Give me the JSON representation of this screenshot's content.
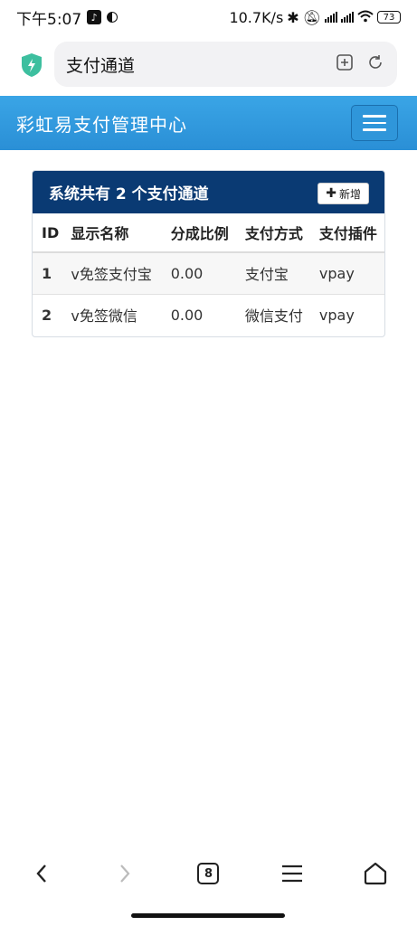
{
  "status_bar": {
    "time": "下午5:07",
    "network_speed": "10.7K/s",
    "battery": "73"
  },
  "browser": {
    "url_title": "支付通道",
    "tab_count": "8"
  },
  "app": {
    "title": "彩虹易支付管理中心"
  },
  "panel": {
    "title": "系统共有 2 个支付通道",
    "add_button": "新增"
  },
  "table": {
    "headers": [
      "ID",
      "显示名称",
      "分成比例",
      "支付方式",
      "支付插件"
    ],
    "rows": [
      {
        "id": "1",
        "name": "v免签支付宝",
        "rate": "0.00",
        "method": "支付宝",
        "plugin": "vpay"
      },
      {
        "id": "2",
        "name": "v免签微信",
        "rate": "0.00",
        "method": "微信支付",
        "plugin": "vpay"
      }
    ]
  },
  "colors": {
    "header_blue": "#2a8fd6",
    "panel_head": "#0a3a73",
    "shield": "#3dbf9f"
  }
}
